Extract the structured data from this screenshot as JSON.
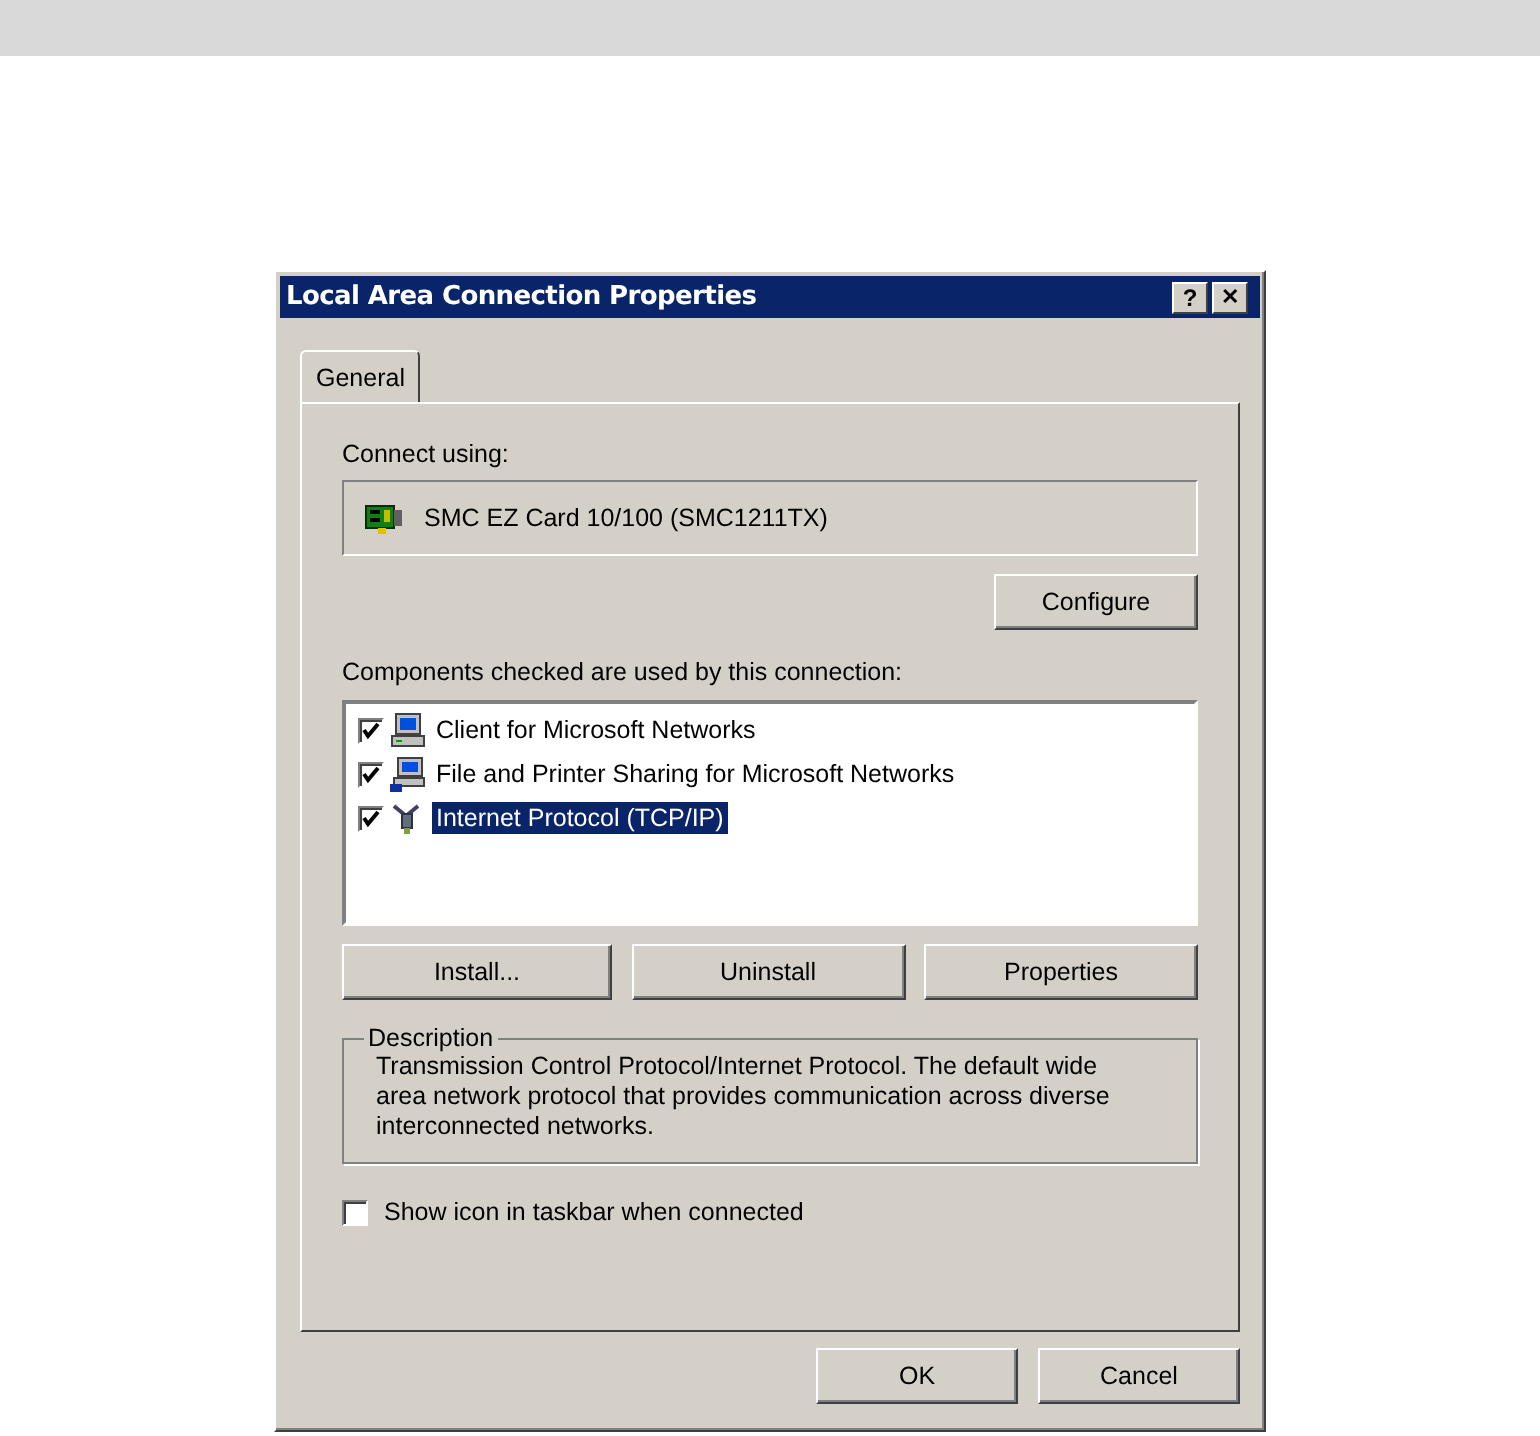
{
  "window": {
    "title": "Local Area Connection Properties",
    "title_buttons": [
      {
        "kind": "help",
        "label": "?"
      },
      {
        "kind": "close",
        "label": "✕"
      }
    ]
  },
  "tabs": [
    {
      "label": "General",
      "selected": true
    }
  ],
  "connect_using": {
    "label": "Connect using:",
    "adapter": "SMC EZ Card 10/100 (SMC1211TX)",
    "button": "Configure"
  },
  "components": {
    "label": "Components checked are used by this connection:",
    "items": [
      {
        "kind": "client",
        "label": "Client for Microsoft Networks",
        "checked": true,
        "selected": false
      },
      {
        "kind": "service",
        "label": "File and Printer Sharing for Microsoft Networks",
        "checked": true,
        "selected": false
      },
      {
        "kind": "protocol",
        "label": "Internet Protocol (TCP/IP)",
        "checked": true,
        "selected": true
      }
    ],
    "buttons": [
      "Install...",
      "Uninstall",
      "Properties"
    ]
  },
  "description": {
    "title": "Description",
    "text": "Transmission Control Protocol/Internet Protocol. The default wide area network protocol that provides communication across diverse interconnected networks."
  },
  "show_icon": {
    "label": "Show icon in taskbar when connected",
    "checked": false
  },
  "buttons": [
    "OK",
    "Cancel"
  ]
}
